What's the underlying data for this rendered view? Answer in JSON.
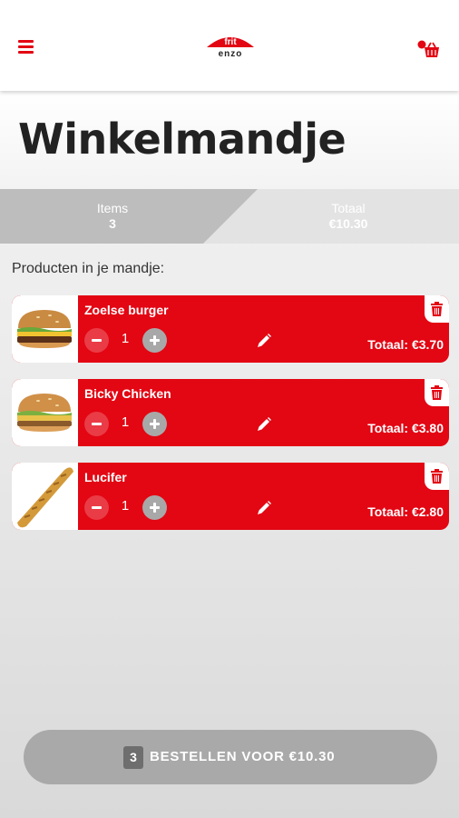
{
  "header": {
    "logo": {
      "line1": "frit",
      "line2": "enzo",
      "color": "#e30613"
    },
    "menu_icon": "hamburger-menu-icon",
    "cart_icon": "basket-icon"
  },
  "page": {
    "title": "Winkelmandje"
  },
  "summary": {
    "items_label": "Items",
    "items_value": "3",
    "total_label": "Totaal",
    "total_value": "€10.30"
  },
  "products_heading": "Producten in je mandje:",
  "cart": {
    "items": [
      {
        "name": "Zoelse burger",
        "quantity": "1",
        "total": "Totaal: €3.70",
        "image": "burger"
      },
      {
        "name": "Bicky Chicken",
        "quantity": "1",
        "total": "Totaal: €3.80",
        "image": "burger"
      },
      {
        "name": "Lucifer",
        "quantity": "1",
        "total": "Totaal: €2.80",
        "image": "snack-stick"
      }
    ]
  },
  "order_button": {
    "count": "3",
    "label": "BESTELLEN VOOR €10.30"
  },
  "colors": {
    "brand_red": "#e30613",
    "summary_left": "#bdbdbd",
    "summary_right": "#e3e3e3",
    "order_button": "#a9a9a9",
    "title_text": "#222222"
  }
}
